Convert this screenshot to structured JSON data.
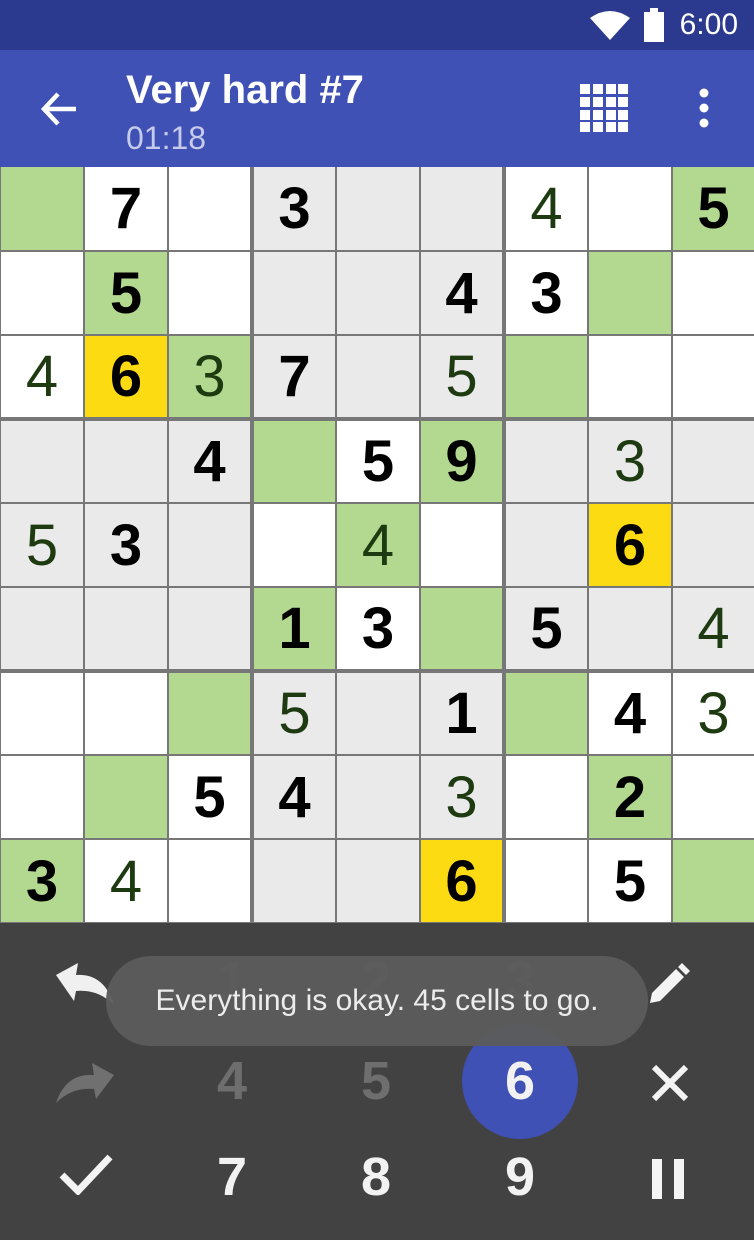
{
  "status": {
    "time": "6:00"
  },
  "toolbar": {
    "title": "Very hard #7",
    "timer": "01:18"
  },
  "board": {
    "rows": [
      [
        {
          "v": "",
          "k": "empty",
          "bg": "green"
        },
        {
          "v": "7",
          "k": "given",
          "bg": "white"
        },
        {
          "v": "",
          "k": "empty",
          "bg": "white"
        },
        {
          "v": "3",
          "k": "given",
          "bg": "gray"
        },
        {
          "v": "",
          "k": "empty",
          "bg": "gray"
        },
        {
          "v": "",
          "k": "empty",
          "bg": "gray"
        },
        {
          "v": "4",
          "k": "entered",
          "bg": "white"
        },
        {
          "v": "",
          "k": "empty",
          "bg": "white"
        },
        {
          "v": "5",
          "k": "given",
          "bg": "green"
        }
      ],
      [
        {
          "v": "",
          "k": "empty",
          "bg": "white"
        },
        {
          "v": "5",
          "k": "given",
          "bg": "green"
        },
        {
          "v": "",
          "k": "empty",
          "bg": "white"
        },
        {
          "v": "",
          "k": "empty",
          "bg": "gray"
        },
        {
          "v": "",
          "k": "empty",
          "bg": "gray"
        },
        {
          "v": "4",
          "k": "given",
          "bg": "gray"
        },
        {
          "v": "3",
          "k": "given",
          "bg": "white"
        },
        {
          "v": "",
          "k": "empty",
          "bg": "green"
        },
        {
          "v": "",
          "k": "empty",
          "bg": "white"
        }
      ],
      [
        {
          "v": "4",
          "k": "entered",
          "bg": "white"
        },
        {
          "v": "6",
          "k": "given",
          "bg": "yellow"
        },
        {
          "v": "3",
          "k": "entered",
          "bg": "green"
        },
        {
          "v": "7",
          "k": "given",
          "bg": "gray"
        },
        {
          "v": "",
          "k": "empty",
          "bg": "gray"
        },
        {
          "v": "5",
          "k": "entered",
          "bg": "gray"
        },
        {
          "v": "",
          "k": "empty",
          "bg": "green"
        },
        {
          "v": "",
          "k": "empty",
          "bg": "white"
        },
        {
          "v": "",
          "k": "empty",
          "bg": "white"
        }
      ],
      [
        {
          "v": "",
          "k": "empty",
          "bg": "gray"
        },
        {
          "v": "",
          "k": "empty",
          "bg": "gray"
        },
        {
          "v": "4",
          "k": "given",
          "bg": "gray"
        },
        {
          "v": "",
          "k": "empty",
          "bg": "green"
        },
        {
          "v": "5",
          "k": "given",
          "bg": "white"
        },
        {
          "v": "9",
          "k": "given",
          "bg": "green"
        },
        {
          "v": "",
          "k": "empty",
          "bg": "gray"
        },
        {
          "v": "3",
          "k": "entered",
          "bg": "gray"
        },
        {
          "v": "",
          "k": "empty",
          "bg": "gray"
        }
      ],
      [
        {
          "v": "5",
          "k": "entered",
          "bg": "gray"
        },
        {
          "v": "3",
          "k": "given",
          "bg": "gray"
        },
        {
          "v": "",
          "k": "empty",
          "bg": "gray"
        },
        {
          "v": "",
          "k": "empty",
          "bg": "white"
        },
        {
          "v": "4",
          "k": "entered",
          "bg": "green"
        },
        {
          "v": "",
          "k": "empty",
          "bg": "white"
        },
        {
          "v": "",
          "k": "empty",
          "bg": "gray"
        },
        {
          "v": "6",
          "k": "given",
          "bg": "yellow"
        },
        {
          "v": "",
          "k": "empty",
          "bg": "gray"
        }
      ],
      [
        {
          "v": "",
          "k": "empty",
          "bg": "gray"
        },
        {
          "v": "",
          "k": "empty",
          "bg": "gray"
        },
        {
          "v": "",
          "k": "empty",
          "bg": "gray"
        },
        {
          "v": "1",
          "k": "given",
          "bg": "green"
        },
        {
          "v": "3",
          "k": "given",
          "bg": "white"
        },
        {
          "v": "",
          "k": "empty",
          "bg": "green"
        },
        {
          "v": "5",
          "k": "given",
          "bg": "gray"
        },
        {
          "v": "",
          "k": "empty",
          "bg": "gray"
        },
        {
          "v": "4",
          "k": "entered",
          "bg": "gray"
        }
      ],
      [
        {
          "v": "",
          "k": "empty",
          "bg": "white"
        },
        {
          "v": "",
          "k": "empty",
          "bg": "white"
        },
        {
          "v": "",
          "k": "empty",
          "bg": "green"
        },
        {
          "v": "5",
          "k": "entered",
          "bg": "gray"
        },
        {
          "v": "",
          "k": "empty",
          "bg": "gray"
        },
        {
          "v": "1",
          "k": "given",
          "bg": "gray"
        },
        {
          "v": "",
          "k": "empty",
          "bg": "green"
        },
        {
          "v": "4",
          "k": "given",
          "bg": "white"
        },
        {
          "v": "3",
          "k": "entered",
          "bg": "white"
        }
      ],
      [
        {
          "v": "",
          "k": "empty",
          "bg": "white"
        },
        {
          "v": "",
          "k": "empty",
          "bg": "green"
        },
        {
          "v": "5",
          "k": "given",
          "bg": "white"
        },
        {
          "v": "4",
          "k": "given",
          "bg": "gray"
        },
        {
          "v": "",
          "k": "empty",
          "bg": "gray"
        },
        {
          "v": "3",
          "k": "entered",
          "bg": "gray"
        },
        {
          "v": "",
          "k": "empty",
          "bg": "white"
        },
        {
          "v": "2",
          "k": "given",
          "bg": "green"
        },
        {
          "v": "",
          "k": "empty",
          "bg": "white"
        }
      ],
      [
        {
          "v": "3",
          "k": "given",
          "bg": "green"
        },
        {
          "v": "4",
          "k": "entered",
          "bg": "white"
        },
        {
          "v": "",
          "k": "empty",
          "bg": "white"
        },
        {
          "v": "",
          "k": "empty",
          "bg": "gray"
        },
        {
          "v": "",
          "k": "empty",
          "bg": "gray"
        },
        {
          "v": "6",
          "k": "given",
          "bg": "yellow"
        },
        {
          "v": "",
          "k": "empty",
          "bg": "white"
        },
        {
          "v": "5",
          "k": "given",
          "bg": "white"
        },
        {
          "v": "",
          "k": "empty",
          "bg": "green"
        }
      ]
    ]
  },
  "keypad": {
    "numbers": [
      {
        "label": "1",
        "state": "dim"
      },
      {
        "label": "2",
        "state": "dim"
      },
      {
        "label": "3",
        "state": "dim"
      },
      {
        "label": "4",
        "state": "dim"
      },
      {
        "label": "5",
        "state": "dim"
      },
      {
        "label": "6",
        "state": "selected"
      },
      {
        "label": "7",
        "state": "normal"
      },
      {
        "label": "8",
        "state": "normal"
      },
      {
        "label": "9",
        "state": "normal"
      }
    ],
    "icons": {
      "undo": "undo-icon",
      "redo": "redo-icon",
      "check": "check-icon",
      "pencil": "pencil-icon",
      "clear": "clear-icon",
      "pause": "pause-icon"
    }
  },
  "toast": {
    "message": "Everything is okay. 45 cells to go."
  },
  "colors": {
    "primary": "#3f51b5",
    "status_bar": "#2b3a8f",
    "given_bg_highlight": "#b3d88f",
    "selected_number": "#fddb12",
    "keypad_bg": "#424242"
  }
}
